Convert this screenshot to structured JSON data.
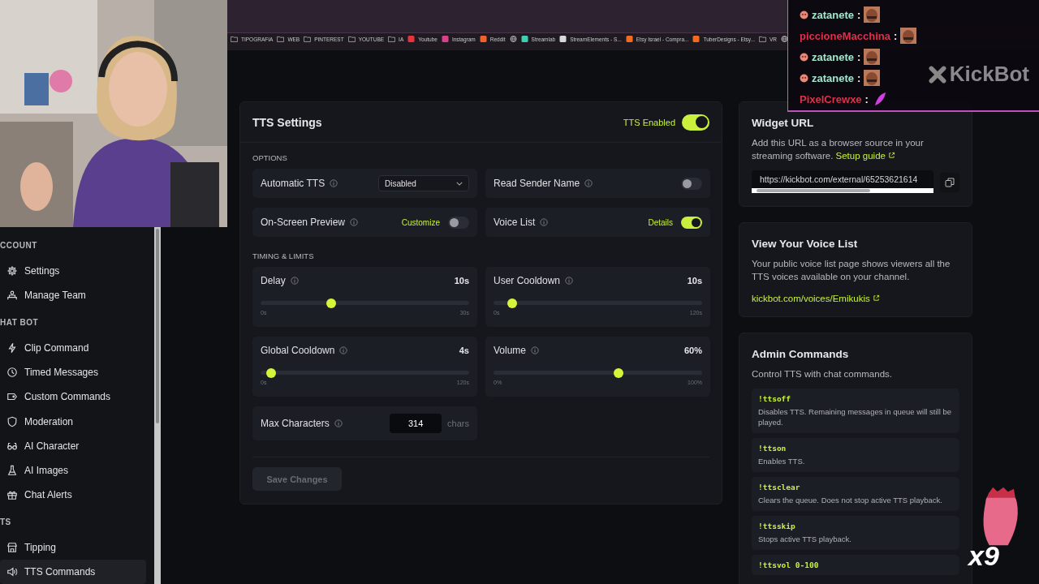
{
  "browser": {
    "bookmarks": [
      {
        "kind": "folder",
        "label": "TIPOGRAFIA"
      },
      {
        "kind": "folder",
        "label": "WEB"
      },
      {
        "kind": "folder",
        "label": "PINTEREST"
      },
      {
        "kind": "folder",
        "label": "YOUTUBE"
      },
      {
        "kind": "folder",
        "label": "IA"
      },
      {
        "kind": "site",
        "label": "Youtube",
        "color": "#e8323c"
      },
      {
        "kind": "site",
        "label": "Instagram",
        "color": "#d8408a"
      },
      {
        "kind": "site",
        "label": "Reddit",
        "color": "#f0602a"
      },
      {
        "kind": "globe"
      },
      {
        "kind": "site",
        "label": "Streamlab",
        "color": "#3ad0b0"
      },
      {
        "kind": "site",
        "label": "StreamElements - S...",
        "color": "#d8d8d8"
      },
      {
        "kind": "site",
        "label": "Etsy Israel - Compra...",
        "color": "#f06a22"
      },
      {
        "kind": "site",
        "label": "TuberDesigns - Etsy...",
        "color": "#f06a22"
      },
      {
        "kind": "folder",
        "label": "VR"
      },
      {
        "kind": "globe"
      }
    ]
  },
  "stream_overlay": {
    "chat": [
      {
        "user": "zatanete",
        "color": "#9fe8cc",
        "badge": true,
        "kind": "face"
      },
      {
        "user": "piccioneMacchina",
        "color": "#e0304a",
        "badge": false,
        "kind": "face"
      },
      {
        "user": "zatanete",
        "color": "#9fe8cc",
        "badge": true,
        "kind": "face"
      },
      {
        "user": "zatanete",
        "color": "#9fe8cc",
        "badge": true,
        "kind": "face"
      },
      {
        "user": "PixelCrewxe",
        "color": "#e0304a",
        "badge": false,
        "kind": "feather"
      }
    ],
    "separator": ":",
    "logo": "KickBot",
    "combo": "x9"
  },
  "sidebar": {
    "sections": [
      {
        "heading": "CCOUNT",
        "items": [
          {
            "label": "Settings",
            "selected": false
          },
          {
            "label": "Manage Team",
            "selected": false
          }
        ]
      },
      {
        "heading": "HAT BOT",
        "items": [
          {
            "label": "Clip Command",
            "selected": false
          },
          {
            "label": "Timed Messages",
            "selected": false
          },
          {
            "label": "Custom Commands",
            "selected": false
          },
          {
            "label": "Moderation",
            "selected": false
          },
          {
            "label": "AI Character",
            "selected": false
          },
          {
            "label": "AI Images",
            "selected": false
          },
          {
            "label": "Chat Alerts",
            "selected": false
          }
        ]
      },
      {
        "heading": "TS",
        "items": [
          {
            "label": "Tipping",
            "selected": false
          },
          {
            "label": "TTS Commands",
            "selected": true
          }
        ]
      }
    ]
  },
  "tts_settings": {
    "title": "TTS Settings",
    "enabled": {
      "label": "TTS Enabled",
      "on": true
    },
    "options_heading": "OPTIONS",
    "options": [
      {
        "kind": "select",
        "label": "Automatic TTS",
        "value": "Disabled"
      },
      {
        "kind": "toggle",
        "label": "Read Sender Name",
        "on": false
      },
      {
        "kind": "toggle",
        "label": "On-Screen Preview",
        "link": "Customize",
        "on": false
      },
      {
        "kind": "toggle",
        "label": "Voice List",
        "link": "Details",
        "on": true
      }
    ],
    "timing_heading": "TIMING & LIMITS",
    "sliders": [
      {
        "label": "Delay",
        "reading": "10s",
        "min": "0s",
        "max": "30s",
        "level": 0.34
      },
      {
        "label": "User Cooldown",
        "reading": "10s",
        "min": "0s",
        "max": "120s",
        "level": 0.09
      },
      {
        "label": "Global Cooldown",
        "reading": "4s",
        "min": "0s",
        "max": "120s",
        "level": 0.05
      },
      {
        "label": "Volume",
        "reading": "60%",
        "min": "0%",
        "max": "100%",
        "level": 0.6
      }
    ],
    "max_characters": {
      "label": "Max Characters",
      "value": "314",
      "unit": "chars"
    },
    "save_button": {
      "label": "Save Changes",
      "disabled": true
    }
  },
  "widget_url": {
    "title": "Widget URL",
    "text": "Add this URL as a browser source in your streaming software.",
    "link": "Setup guide",
    "url": "https://kickbot.com/external/65253621614"
  },
  "voice_list": {
    "title": "View Your Voice List",
    "text": "Your public voice list page shows viewers all the TTS voices available on your channel.",
    "link": "kickbot.com/voices/Emikukis"
  },
  "admin_commands": {
    "title": "Admin Commands",
    "subtitle": "Control TTS with chat commands.",
    "commands": [
      {
        "command": "!ttsoff",
        "description": "Disables TTS. Remaining messages in queue will still be played."
      },
      {
        "command": "!ttson",
        "description": "Enables TTS."
      },
      {
        "command": "!ttsclear",
        "description": "Clears the queue. Does not stop active TTS playback."
      },
      {
        "command": "!ttsskip",
        "description": "Stops active TTS playback."
      },
      {
        "command": "!ttsvol 0-100"
      }
    ]
  }
}
